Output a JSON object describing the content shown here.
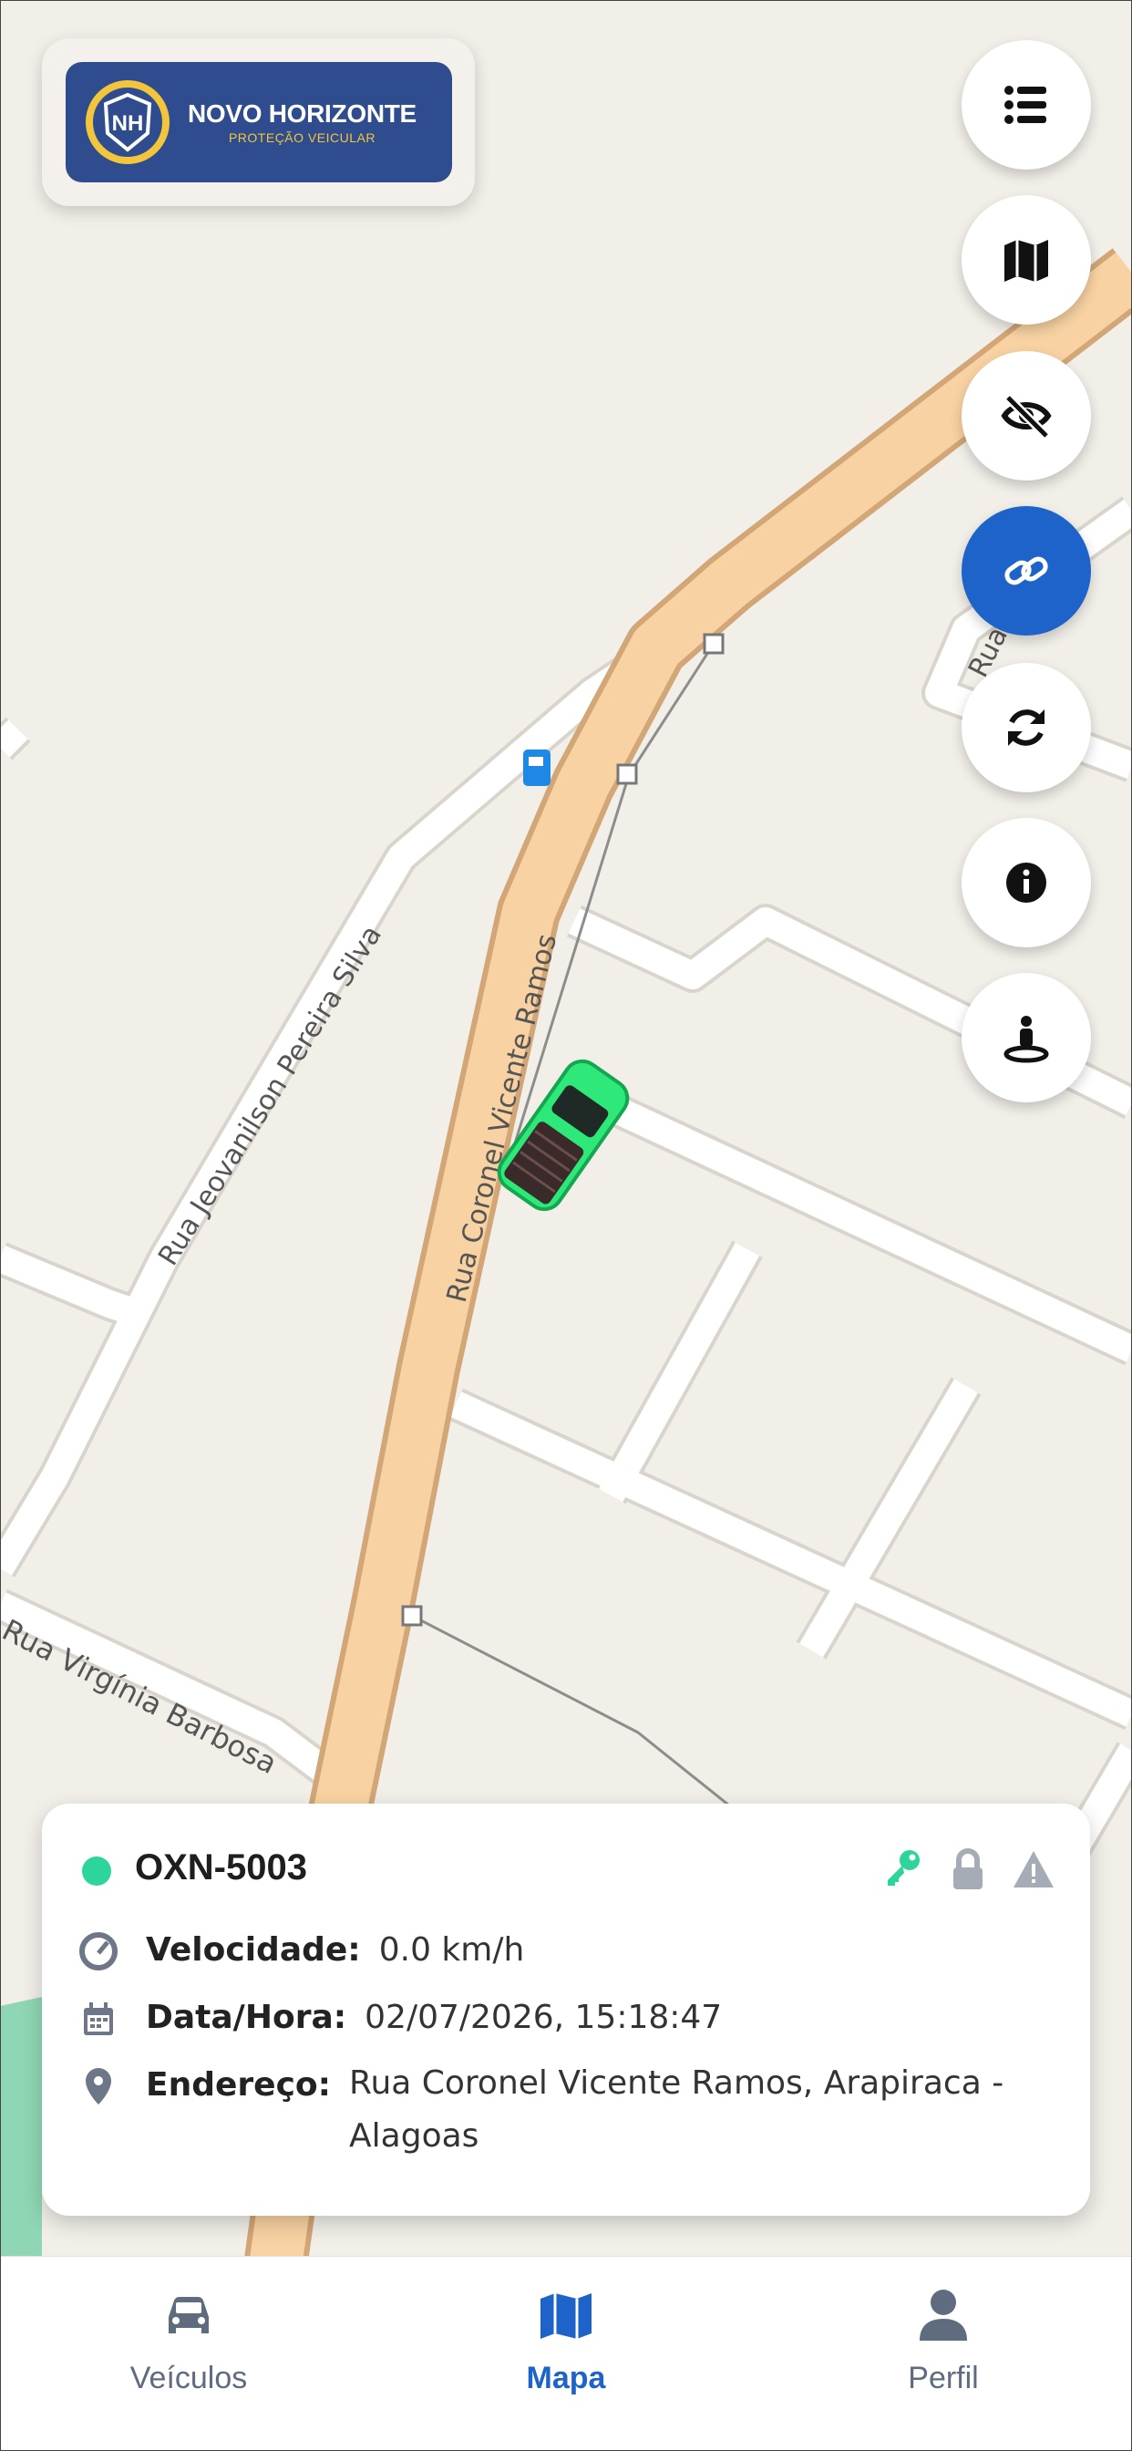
{
  "logo": {
    "initials": "NH",
    "name": "NOVO HORIZONTE",
    "tagline": "PROTEÇÃO VEICULAR"
  },
  "map": {
    "streets": [
      "Rua Jeovanilson Pereira Silva",
      "Rua Coronel Vicente Ramos",
      "Rua Virgínia Barbosa",
      "Rua"
    ]
  },
  "fabs": [
    {
      "icon": "list-icon"
    },
    {
      "icon": "map-icon"
    },
    {
      "icon": "eye-slash-icon"
    },
    {
      "icon": "link-icon",
      "active": true
    },
    {
      "icon": "refresh-icon"
    },
    {
      "icon": "info-icon"
    },
    {
      "icon": "street-view-icon"
    }
  ],
  "vehicle": {
    "plate": "OXN-5003",
    "status_color": "#2ed59a",
    "speed_label": "Velocidade:",
    "speed_value": "0.0 km/h",
    "datetime_label": "Data/Hora:",
    "datetime_value": "02/07/2026, 15:18:47",
    "address_label": "Endereço:",
    "address_line1": "Rua Coronel Vicente Ramos, Arapiraca -",
    "address_line2": "Alagoas",
    "status_icons": [
      "key-icon",
      "lock-icon",
      "warning-icon"
    ]
  },
  "tabs": [
    {
      "label": "Veículos",
      "icon": "car-icon"
    },
    {
      "label": "Mapa",
      "icon": "map-icon",
      "active": true
    },
    {
      "label": "Perfil",
      "icon": "user-icon"
    }
  ],
  "colors": {
    "accent": "#1e63c9",
    "map_bg": "#f2efe9",
    "main_road": "#f8d2a2",
    "online": "#2ed59a"
  }
}
